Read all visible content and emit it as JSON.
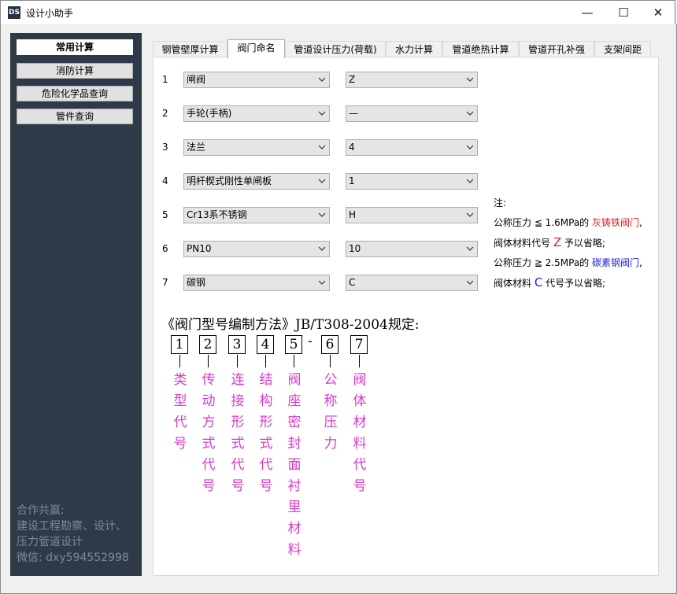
{
  "window": {
    "title": "设计小助手",
    "icon_text": "DS",
    "minimize": "—",
    "maximize": "☐",
    "close": "✕"
  },
  "sidebar": {
    "items": [
      {
        "label": "常用计算",
        "active": true
      },
      {
        "label": "消防计算",
        "active": false
      },
      {
        "label": "危险化学品查询",
        "active": false
      },
      {
        "label": "管件查询",
        "active": false
      }
    ],
    "footer": [
      "合作共赢:",
      "建设工程勘察、设计、",
      "压力管道设计",
      "微信: dxy594552998"
    ]
  },
  "tabs": [
    "钢管壁厚计算",
    "阀门命名",
    "管道设计压力(荷载)",
    "水力计算",
    "管道绝热计算",
    "管道开孔补强",
    "支架间距"
  ],
  "selected_tab": "阀门命名",
  "rows": [
    {
      "num": "1",
      "name": "闸阀",
      "code": "Z"
    },
    {
      "num": "2",
      "name": "手轮(手柄)",
      "code": "—"
    },
    {
      "num": "3",
      "name": "法兰",
      "code": "4"
    },
    {
      "num": "4",
      "name": "明杆楔式刚性单闸板",
      "code": "1"
    },
    {
      "num": "5",
      "name": "Cr13系不锈钢",
      "code": "H"
    },
    {
      "num": "6",
      "name": "PN10",
      "code": "10"
    },
    {
      "num": "7",
      "name": "碳钢",
      "code": "C"
    }
  ],
  "note": {
    "title": "注:",
    "line1_a": "公称压力 ≦ 1.6MPa的 ",
    "line1_b": "灰铸铁阀门",
    "line1_c": ",",
    "line2_a": "阀体材料代号 ",
    "line2_b": "Z",
    "line2_c": " 予以省略;",
    "line3_a": "公称压力 ≧ 2.5MPa的 ",
    "line3_b": "碳素钢阀门",
    "line3_c": ",",
    "line4_a": "阀体材料 ",
    "line4_b": "C",
    "line4_c": " 代号予以省略;"
  },
  "diagram": {
    "heading": "《阀门型号编制方法》JB/T308-2004规定:",
    "digits": [
      "1",
      "2",
      "3",
      "4",
      "5",
      "6",
      "7"
    ],
    "dash": "-",
    "labels": [
      "类型代号",
      "传动方式代号",
      "连接形式代号",
      "结构形式代号",
      "阀座密封面衬里材料",
      "公称压力",
      "阀体材料代号"
    ],
    "label_color": "#d83ac8"
  }
}
